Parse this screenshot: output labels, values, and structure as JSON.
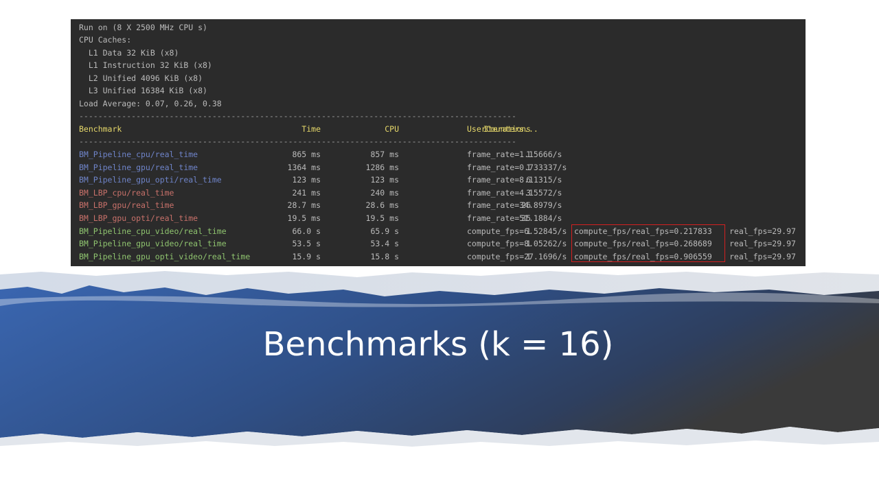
{
  "slide": {
    "title": "Benchmarks (k = 16)"
  },
  "terminal": {
    "info_lines": [
      "Run on (8 X 2500 MHz CPU s)",
      "CPU Caches:",
      "  L1 Data 32 KiB (x8)",
      "  L1 Instruction 32 KiB (x8)",
      "  L2 Unified 4096 KiB (x8)",
      "  L3 Unified 16384 KiB (x8)",
      "Load Average: 0.07, 0.26, 0.38"
    ],
    "separator": "--------------------------------------------------------------------------------------------",
    "header": {
      "benchmark": "Benchmark",
      "time": "Time",
      "cpu": "CPU",
      "iterations": "Iterations",
      "user_counters": "UserCounters..."
    },
    "rows": [
      {
        "name": "BM_Pipeline_cpu/real_time",
        "time": "865 ms",
        "cpu": "857 ms",
        "iterations": "1",
        "counter": "frame_rate=1.15666/s",
        "ratio": "",
        "real_fps": ""
      },
      {
        "name": "BM_Pipeline_gpu/real_time",
        "time": "1364 ms",
        "cpu": "1286 ms",
        "iterations": "1",
        "counter": "frame_rate=0.733337/s",
        "ratio": "",
        "real_fps": ""
      },
      {
        "name": "BM_Pipeline_gpu_opti/real_time",
        "time": "123 ms",
        "cpu": "123 ms",
        "iterations": "6",
        "counter": "frame_rate=8.11315/s",
        "ratio": "",
        "real_fps": ""
      },
      {
        "name": "BM_LBP_cpu/real_time",
        "time": "241 ms",
        "cpu": "240 ms",
        "iterations": "3",
        "counter": "frame_rate=4.15572/s",
        "ratio": "",
        "real_fps": ""
      },
      {
        "name": "BM_LBP_gpu/real_time",
        "time": "28.7 ms",
        "cpu": "28.6 ms",
        "iterations": "26",
        "counter": "frame_rate=34.8979/s",
        "ratio": "",
        "real_fps": ""
      },
      {
        "name": "BM_LBP_gpu_opti/real_time",
        "time": "19.5 ms",
        "cpu": "19.5 ms",
        "iterations": "35",
        "counter": "frame_rate=51.1884/s",
        "ratio": "",
        "real_fps": ""
      },
      {
        "name": "BM_Pipeline_cpu_video/real_time",
        "time": "66.0 s",
        "cpu": "65.9 s",
        "iterations": "1",
        "counter": "compute_fps=6.52845/s",
        "ratio": "compute_fps/real_fps=0.217833",
        "real_fps": "real_fps=29.97"
      },
      {
        "name": "BM_Pipeline_gpu_video/real_time",
        "time": "53.5 s",
        "cpu": "53.4 s",
        "iterations": "1",
        "counter": "compute_fps=8.05262/s",
        "ratio": "compute_fps/real_fps=0.268689",
        "real_fps": "real_fps=29.97"
      },
      {
        "name": "BM_Pipeline_gpu_opti_video/real_time",
        "time": "15.9 s",
        "cpu": "15.8 s",
        "iterations": "1",
        "counter": "compute_fps=27.1696/s",
        "ratio": "compute_fps/real_fps=0.906559",
        "real_fps": "real_fps=29.97"
      }
    ]
  },
  "colors": {
    "terminal_bg": "#2b2b2b",
    "text": "#bbbbbb",
    "header": "#e6d86a",
    "name_cpu_gpu": "#6f84c9",
    "name_lbp": "#c8716a",
    "name_video": "#8fc46f",
    "highlight": "#d42020",
    "band_left": "#3560a8",
    "band_right": "#3a3a3a"
  }
}
